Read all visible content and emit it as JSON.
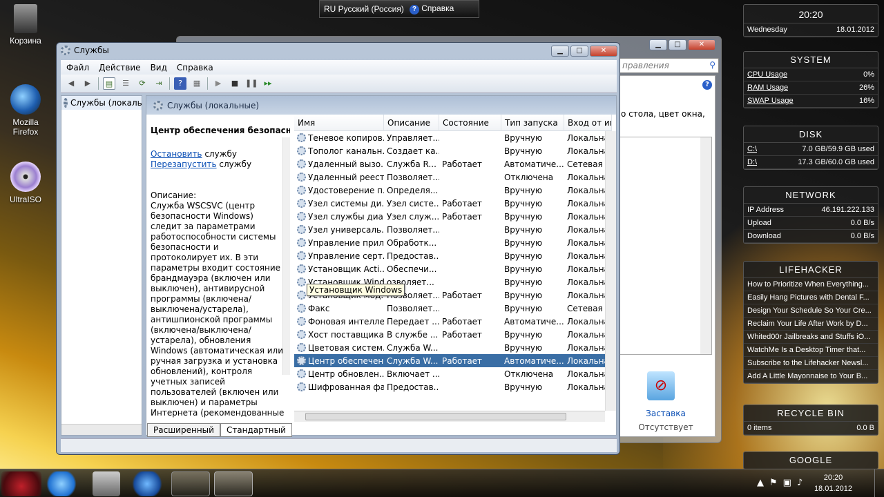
{
  "language_bar": {
    "lang": "RU Русский (Россия)",
    "help": "Справка"
  },
  "desktop_icons": [
    {
      "label": "Корзина"
    },
    {
      "label": "Mozilla Firefox"
    },
    {
      "label": "UltraISO"
    }
  ],
  "window": {
    "title": "Службы",
    "menu": [
      "Файл",
      "Действие",
      "Вид",
      "Справка"
    ],
    "tree_node": "Службы (локальные)",
    "panel_title": "Службы (локальные)",
    "details": {
      "service_title": "Центр обеспечения безопасности",
      "stop_link": "Остановить",
      "stop_suffix": " службу",
      "restart_link": "Перезапустить",
      "restart_suffix": " службу",
      "desc_label": "Описание:",
      "desc_text": "Служба WSCSVC (центр безопасности Windows) следит за параметрами работоспособности системы безопасности и протоколирует их. В эти параметры входит состояние брандмауэра (включен или выключен), антивирусной программы (включена/выключена/устарела), антишпионской программы (включена/выключена/устарела), обновления Windows (автоматическая или ручная загрузка и установка обновлений), контроля учетных записей пользователей (включен или выключен) и параметры Интернета (рекомендованные или отличающиеся от рекомендованных). Служба"
    },
    "columns": [
      "Имя",
      "Описание",
      "Состояние",
      "Тип запуска",
      "Вход от имени"
    ],
    "rows": [
      [
        "Теневое копиров...",
        "Управляет...",
        "",
        "Вручную",
        "Локальна"
      ],
      [
        "Тополог канальн...",
        "Создает ка...",
        "",
        "Вручную",
        "Локальна"
      ],
      [
        "Удаленный вызо...",
        "Служба R...",
        "Работает",
        "Автоматиче...",
        "Сетевая с"
      ],
      [
        "Удаленный реестр",
        "Позволяет...",
        "",
        "Отключена",
        "Локальна"
      ],
      [
        "Удостоверение п...",
        "Определя...",
        "",
        "Вручную",
        "Локальна"
      ],
      [
        "Узел системы ди...",
        "Узел систе...",
        "Работает",
        "Вручную",
        "Локальна"
      ],
      [
        "Узел службы диа...",
        "Узел служ...",
        "Работает",
        "Вручную",
        "Локальна"
      ],
      [
        "Узел универсаль...",
        "Позволяет...",
        "",
        "Вручную",
        "Локальна"
      ],
      [
        "Управление прил...",
        "Обработк...",
        "",
        "Вручную",
        "Локальна"
      ],
      [
        "Управление серт...",
        "Предостав...",
        "",
        "Вручную",
        "Локальна"
      ],
      [
        "Установщик Acti...",
        "Обеспечи...",
        "",
        "Вручную",
        "Локальна"
      ],
      [
        "Установщик Windows",
        "озволяет...",
        "",
        "Вручную",
        "Локальна"
      ],
      [
        "Установщик мод...",
        "Позволяет...",
        "Работает",
        "Вручную",
        "Локальна"
      ],
      [
        "Факс",
        "Позволяет...",
        "",
        "Вручную",
        "Сетевая с"
      ],
      [
        "Фоновая интелле...",
        "Передает ...",
        "Работает",
        "Автоматиче...",
        "Локальна"
      ],
      [
        "Хост поставщика...",
        "В службе ...",
        "Работает",
        "Вручную",
        "Локальна"
      ],
      [
        "Цветовая систем...",
        "Служба W...",
        "",
        "Вручную",
        "Локальна"
      ],
      [
        "Центр обеспечен...",
        "Служба W...",
        "Работает",
        "Автоматиче...",
        "Локальна"
      ],
      [
        "Центр обновлен...",
        "Включает ...",
        "",
        "Отключена",
        "Локальна"
      ],
      [
        "Шифрованная фа...",
        "Предостав...",
        "",
        "Вручную",
        "Локальна"
      ]
    ],
    "selected_row": 17,
    "tooltip": "Установщик Windows",
    "tabs": [
      "Расширенный",
      "Стандартный"
    ]
  },
  "background_window": {
    "search_placeholder": "правления",
    "text": "о стола, цвет окна,",
    "screensaver": "Заставка",
    "screensaver_status": "Отсутствует"
  },
  "gadgets": {
    "clock": {
      "time": "20:20",
      "day": "Wednesday",
      "date": "18.01.2012"
    },
    "system": {
      "title": "SYSTEM",
      "rows": [
        [
          "CPU Usage",
          "0%"
        ],
        [
          "RAM Usage",
          "26%"
        ],
        [
          "SWAP Usage",
          "16%"
        ]
      ]
    },
    "disk": {
      "title": "DISK",
      "rows": [
        [
          "C:\\",
          "7.0 GB/59.9 GB used"
        ],
        [
          "D:\\",
          "17.3 GB/60.0 GB used"
        ]
      ]
    },
    "network": {
      "title": "NETWORK",
      "rows": [
        [
          "IP Address",
          "46.191.222.133"
        ],
        [
          "Upload",
          "0.0 B/s"
        ],
        [
          "Download",
          "0.0 B/s"
        ]
      ]
    },
    "lifehacker": {
      "title": "LIFEHACKER",
      "items": [
        "How to Prioritize When Everything...",
        "Easily Hang Pictures with Dental F...",
        "Design Your Schedule So Your Cre...",
        "Reclaim Your Life After Work by D...",
        "Whited00r Jailbreaks and Stuffs iO...",
        "WatchMe Is a Desktop Timer that...",
        "Subscribe to the Lifehacker Newsl...",
        "Add A Little Mayonnaise to Your B..."
      ]
    },
    "recycle": {
      "title": "RECYCLE BIN",
      "items": "0 items",
      "size": "0.0 B"
    },
    "google": {
      "title": "GOOGLE"
    }
  },
  "taskbar": {
    "time": "20:20",
    "date": "18.01.2012"
  }
}
